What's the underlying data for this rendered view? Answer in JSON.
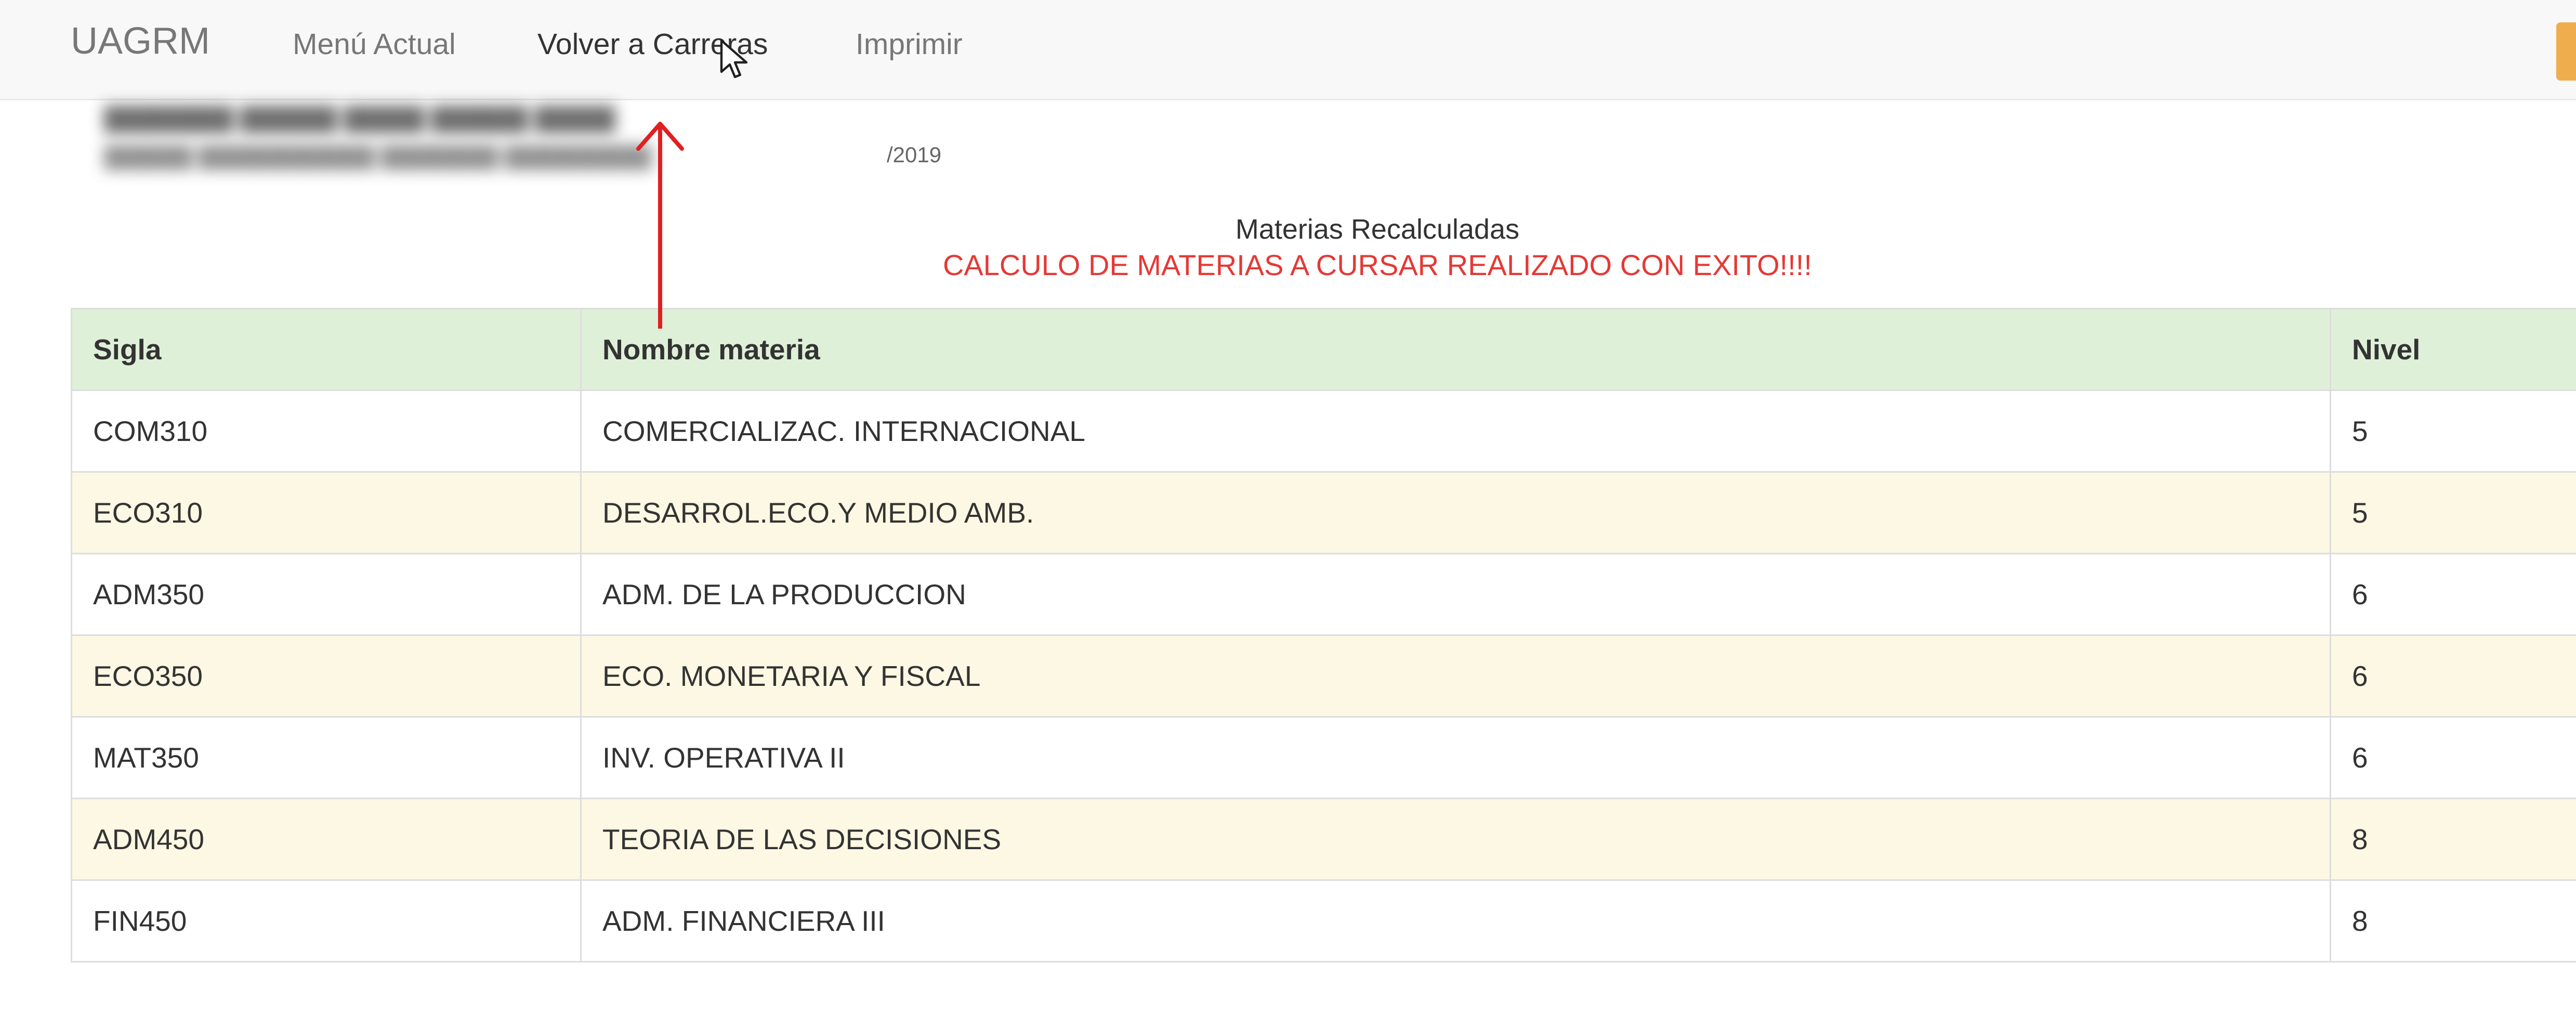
{
  "navbar": {
    "brand": "UAGRM",
    "links": [
      {
        "label": "Menú Actual"
      },
      {
        "label": "Volver a Carreras"
      },
      {
        "label": "Imprimir"
      }
    ]
  },
  "student": {
    "date_fragment": "/2019"
  },
  "main": {
    "subtitle": "Materias Recalculadas",
    "success_message": "CALCULO DE MATERIAS A CURSAR REALIZADO CON EXITO!!!!",
    "success_color": "#e53935"
  },
  "table": {
    "headers": [
      "Sigla",
      "Nombre materia",
      "Nivel"
    ],
    "rows": [
      {
        "sigla": "COM310",
        "nombre": "COMERCIALIZAC. INTERNACIONAL",
        "nivel": "5"
      },
      {
        "sigla": "ECO310",
        "nombre": "DESARROL.ECO.Y MEDIO AMB.",
        "nivel": "5"
      },
      {
        "sigla": "ADM350",
        "nombre": "ADM. DE LA PRODUCCION",
        "nivel": "6"
      },
      {
        "sigla": "ECO350",
        "nombre": "ECO. MONETARIA Y FISCAL",
        "nivel": "6"
      },
      {
        "sigla": "MAT350",
        "nombre": "INV. OPERATIVA II",
        "nivel": "6"
      },
      {
        "sigla": "ADM450",
        "nombre": "TEORIA DE LAS DECISIONES",
        "nivel": "8"
      },
      {
        "sigla": "FIN450",
        "nombre": "ADM. FINANCIERA III",
        "nivel": "8"
      }
    ]
  },
  "colors": {
    "header_bg": "#dff0d8",
    "odd_row_bg": "#ffffff",
    "even_row_bg": "#fcf8e3",
    "annotation_arrow": "#e02020"
  },
  "icons": [
    "mouse-cursor-icon",
    "annotation-arrow-icon"
  ]
}
